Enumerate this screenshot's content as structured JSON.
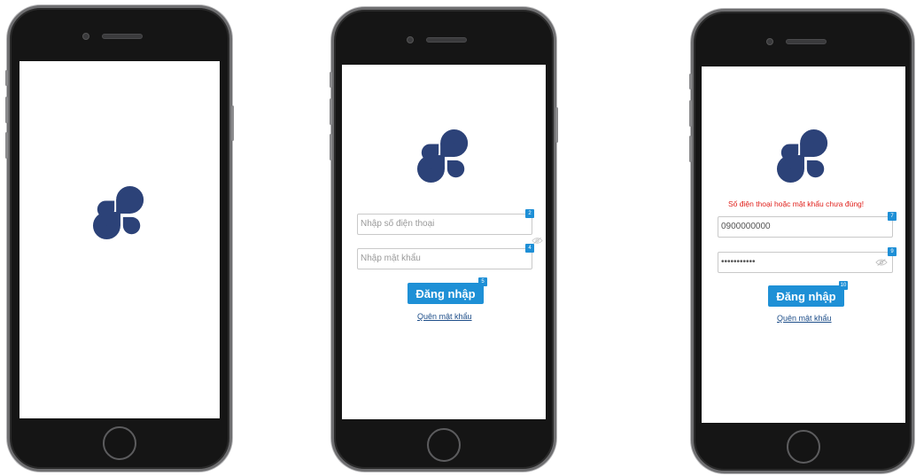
{
  "brand": {
    "logo_color": "#2c4278",
    "accent": "#1e90d6",
    "error_color": "#e0201b"
  },
  "screens": [
    {
      "name": "splash"
    },
    {
      "name": "login",
      "phone_placeholder": "Nhập số điện thoại",
      "password_placeholder": "Nhập mật khẩu",
      "phone_badge": "2",
      "password_badge": "4",
      "login_badge": "5",
      "login_label": "Đăng nhập",
      "forgot_label": "Quên mật khẩu"
    },
    {
      "name": "login-error",
      "error_message": "Số điện thoại hoặc mật khẩu chưa đúng!",
      "phone_value": "0900000000",
      "password_value": "•••••••••••",
      "phone_badge": "7",
      "password_badge": "9",
      "login_badge": "10",
      "login_label": "Đăng nhập",
      "forgot_label": "Quên mật khẩu"
    }
  ]
}
